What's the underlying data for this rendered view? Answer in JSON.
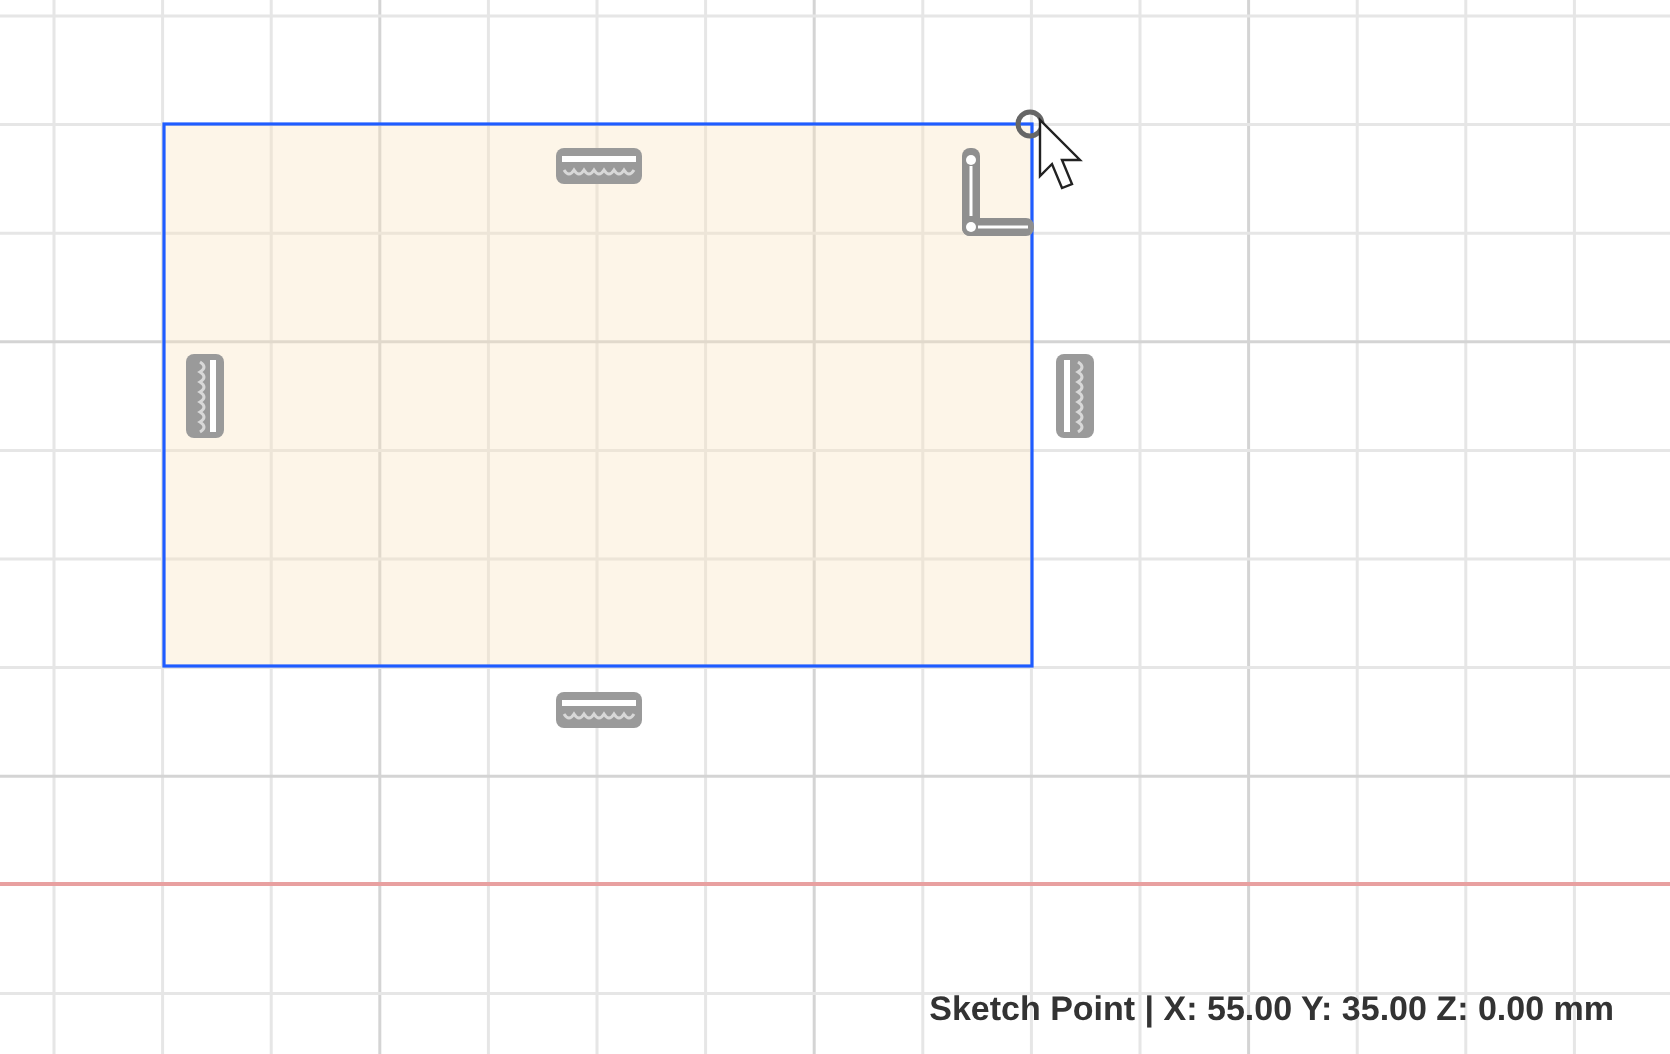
{
  "sketch": {
    "rectangle": {
      "selected": true
    }
  },
  "status_bar": {
    "text": "Sketch Point | X: 55.00 Y: 35.00 Z: 0.00 mm"
  }
}
